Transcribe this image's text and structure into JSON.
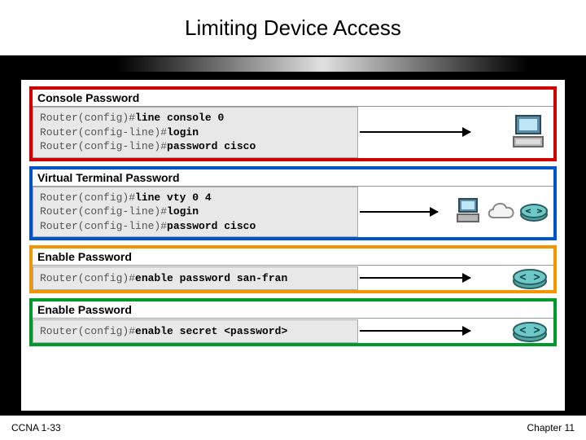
{
  "title": "Limiting Device Access",
  "footer": {
    "left": "CCNA 1-33",
    "right": "Chapter 11"
  },
  "sections": [
    {
      "color": "red",
      "header": "Console Password",
      "lines": [
        {
          "prompt": "Router(config)#",
          "cmd": "line console 0"
        },
        {
          "prompt": "Router(config-line)#",
          "cmd": "login"
        },
        {
          "prompt": "Router(config-line)#",
          "cmd": "password cisco"
        }
      ],
      "icons": [
        "pc"
      ]
    },
    {
      "color": "blue",
      "header": "Virtual Terminal Password",
      "lines": [
        {
          "prompt": "Router(config)#",
          "cmd": "line vty 0 4"
        },
        {
          "prompt": "Router(config-line)#",
          "cmd": "login"
        },
        {
          "prompt": "Router(config-line)#",
          "cmd": "password cisco"
        }
      ],
      "icons": [
        "pc",
        "cloud",
        "router"
      ]
    },
    {
      "color": "orange",
      "header": "Enable Password",
      "lines": [
        {
          "prompt": "Router(config)#",
          "cmd": "enable password san-fran"
        }
      ],
      "icons": [
        "router"
      ]
    },
    {
      "color": "green",
      "header": "Enable Password",
      "lines": [
        {
          "prompt": "Router(config)#",
          "cmd": "enable secret <password>"
        }
      ],
      "icons": [
        "router"
      ]
    }
  ]
}
